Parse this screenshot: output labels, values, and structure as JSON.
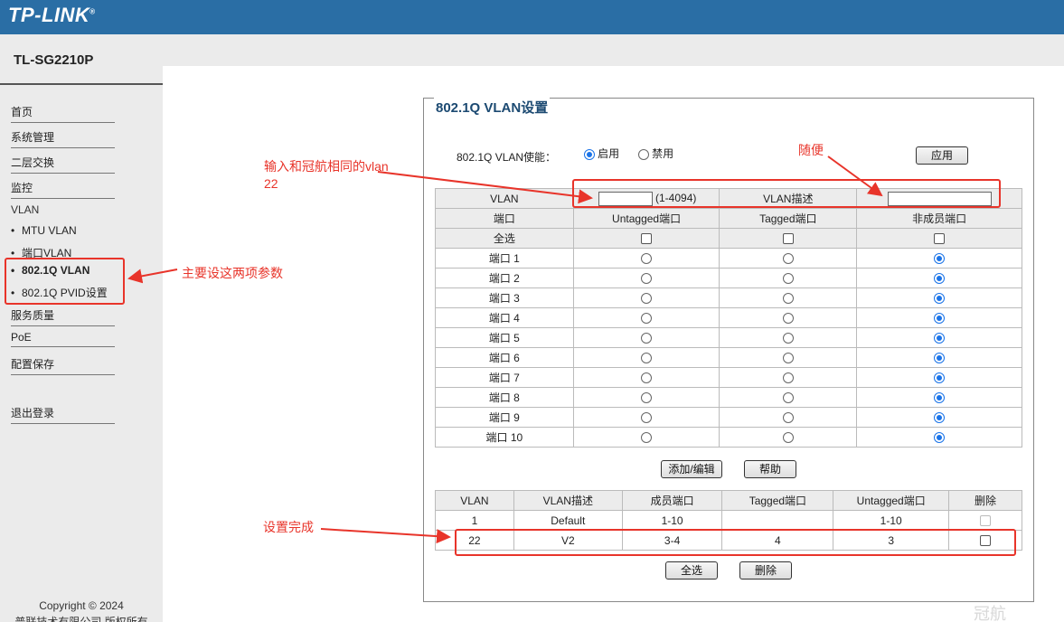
{
  "header": {
    "logo": "TP-LINK",
    "logo_mark": "®",
    "model": "TL-SG2210P"
  },
  "sidebar": {
    "items": [
      {
        "label": "首页"
      },
      {
        "label": "系统管理"
      },
      {
        "label": "二层交换"
      },
      {
        "label": "监控"
      }
    ],
    "vlan_label": "VLAN",
    "vlan_sub": [
      {
        "label": "MTU VLAN"
      },
      {
        "label": "端口VLAN"
      },
      {
        "label": "802.1Q VLAN",
        "active": true
      },
      {
        "label": "802.1Q PVID设置"
      }
    ],
    "items2": [
      {
        "label": "服务质量"
      },
      {
        "label": "PoE"
      },
      {
        "label": "配置保存"
      }
    ],
    "logout": "退出登录",
    "copyright_line1": "Copyright © 2024",
    "copyright_line2": "普联技术有限公司 版权所有"
  },
  "panel": {
    "title": "802.1Q VLAN设置",
    "enable_label": "802.1Q VLAN使能：",
    "enable_on": "启用",
    "enable_off": "禁用",
    "apply_button": "应用",
    "vlan_label": "VLAN",
    "vlan_id_value": "",
    "vlan_range": "(1-4094)",
    "vlan_desc_label": "VLAN描述",
    "vlan_desc_value": "",
    "col_port": "端口",
    "col_untagged": "Untagged端口",
    "col_tagged": "Tagged端口",
    "col_nonmember": "非成员端口",
    "select_all_row": "全选",
    "ports": [
      {
        "name": "端口 1",
        "mode": "nonmember"
      },
      {
        "name": "端口 2",
        "mode": "nonmember"
      },
      {
        "name": "端口 3",
        "mode": "nonmember"
      },
      {
        "name": "端口 4",
        "mode": "nonmember"
      },
      {
        "name": "端口 5",
        "mode": "nonmember"
      },
      {
        "name": "端口 6",
        "mode": "nonmember"
      },
      {
        "name": "端口 7",
        "mode": "nonmember"
      },
      {
        "name": "端口 8",
        "mode": "nonmember"
      },
      {
        "name": "端口 9",
        "mode": "nonmember"
      },
      {
        "name": "端口 10",
        "mode": "nonmember"
      }
    ],
    "add_button": "添加/编辑",
    "help_button": "帮助",
    "list_headers": [
      "VLAN",
      "VLAN描述",
      "成员端口",
      "Tagged端口",
      "Untagged端口",
      "删除"
    ],
    "list_rows": [
      {
        "vlan": "1",
        "desc": "Default",
        "members": "1-10",
        "tagged": "",
        "untagged": "1-10",
        "deletable": false
      },
      {
        "vlan": "22",
        "desc": "V2",
        "members": "3-4",
        "tagged": "4",
        "untagged": "3",
        "deletable": true
      }
    ],
    "select_all_button": "全选",
    "delete_button": "删除"
  },
  "annotations": {
    "input_note_line1": "输入和冠航相同的vlan",
    "input_note_line2": "22",
    "random_note": "随便",
    "params_note": "主要设这两项参数",
    "done_note": "设置完成"
  },
  "watermark": "冠航",
  "colors": {
    "topbar": "#2a6ea5",
    "accent": "#1a73e8",
    "annotation": "#e8342a"
  }
}
